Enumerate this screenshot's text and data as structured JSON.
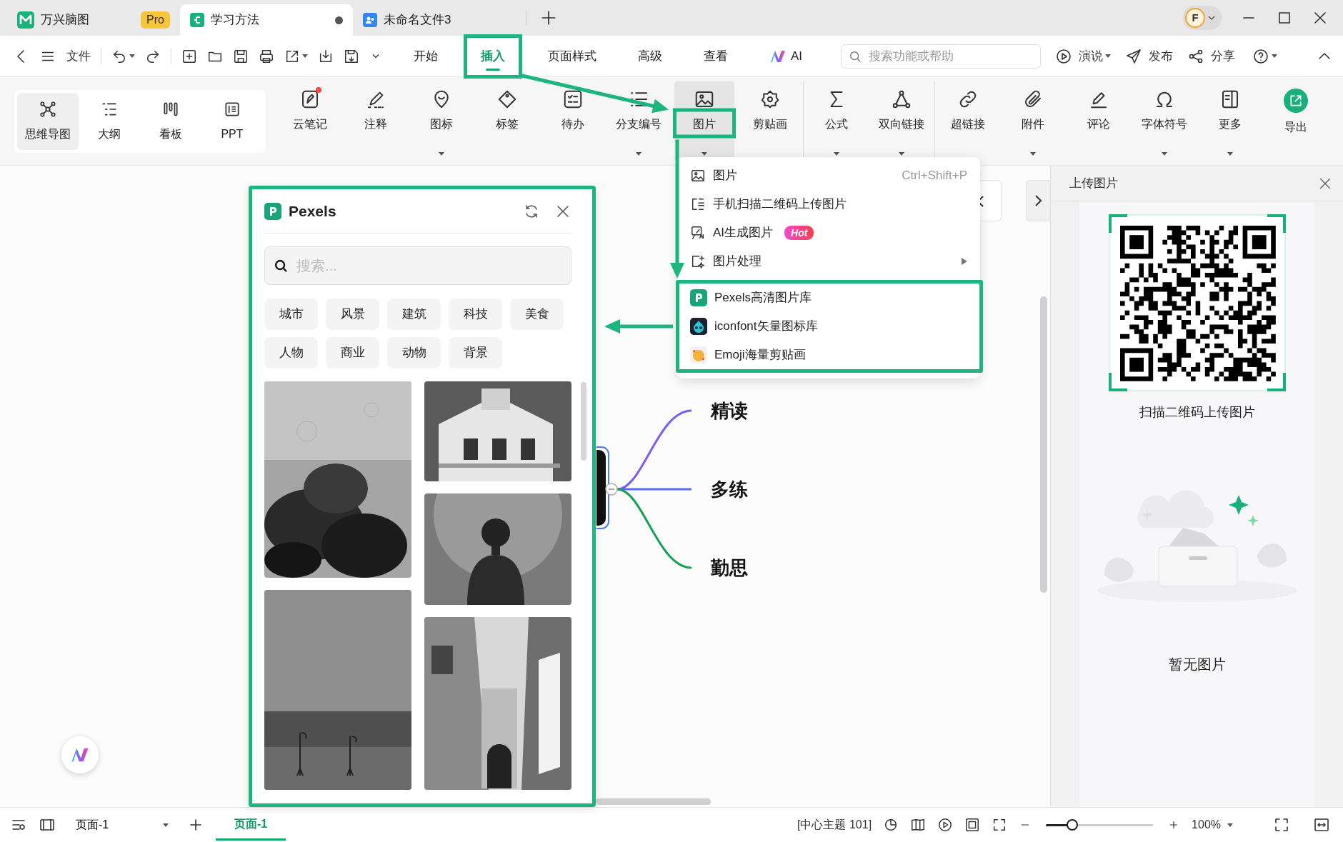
{
  "title_tabs": [
    {
      "label": "万兴脑图",
      "badge": "Pro",
      "selected": false,
      "unsaved": false
    },
    {
      "label": "学习方法",
      "selected": true,
      "unsaved": true
    },
    {
      "label": "未命名文件3",
      "selected": false,
      "unsaved": false
    }
  ],
  "account": {
    "avatar": "F"
  },
  "menu_bar": {
    "file": "文件",
    "tabs": [
      {
        "label": "开始",
        "selected": false,
        "highlighted": false,
        "kind": "text"
      },
      {
        "label": "插入",
        "selected": true,
        "highlighted": true,
        "kind": "text"
      },
      {
        "label": "页面样式",
        "selected": false,
        "highlighted": false,
        "kind": "text"
      },
      {
        "label": "高级",
        "selected": false,
        "highlighted": false,
        "kind": "text"
      },
      {
        "label": "查看",
        "selected": false,
        "highlighted": false,
        "kind": "text"
      },
      {
        "label": "AI",
        "selected": false,
        "highlighted": false,
        "kind": "ai"
      }
    ],
    "search": {
      "placeholder": "搜索功能或帮助"
    },
    "actions": [
      {
        "label": "演说",
        "dropdown": true
      },
      {
        "label": "发布",
        "dropdown": false
      },
      {
        "label": "分享",
        "dropdown": false
      }
    ]
  },
  "ribbon": {
    "views": [
      {
        "label": "思维导图",
        "selected": true
      },
      {
        "label": "大纲",
        "selected": false
      },
      {
        "label": "看板",
        "selected": false
      },
      {
        "label": "PPT",
        "selected": false
      }
    ],
    "tools": [
      {
        "label": "云笔记",
        "kind": "plain",
        "dropdown": false,
        "selected": false,
        "highlighted": false,
        "dot": true,
        "divider_before": false
      },
      {
        "label": "注释",
        "kind": "plain",
        "dropdown": false,
        "selected": false,
        "highlighted": false,
        "dot": false,
        "divider_before": false
      },
      {
        "label": "图标",
        "kind": "plain",
        "dropdown": true,
        "selected": false,
        "highlighted": false,
        "dot": false,
        "divider_before": false
      },
      {
        "label": "标签",
        "kind": "plain",
        "dropdown": false,
        "selected": false,
        "highlighted": false,
        "dot": false,
        "divider_before": false
      },
      {
        "label": "待办",
        "kind": "plain",
        "dropdown": false,
        "selected": false,
        "highlighted": false,
        "dot": false,
        "divider_before": false
      },
      {
        "label": "分支编号",
        "kind": "plain",
        "dropdown": true,
        "selected": false,
        "highlighted": false,
        "dot": false,
        "divider_before": false
      },
      {
        "label": "图片",
        "kind": "plain",
        "dropdown": true,
        "selected": true,
        "highlighted": true,
        "dot": false,
        "divider_before": false
      },
      {
        "label": "剪贴画",
        "kind": "plain",
        "dropdown": false,
        "selected": false,
        "highlighted": false,
        "dot": false,
        "divider_before": false
      },
      {
        "label": "公式",
        "kind": "plain",
        "dropdown": true,
        "selected": false,
        "highlighted": false,
        "dot": false,
        "divider_before": true
      },
      {
        "label": "双向链接",
        "kind": "plain",
        "dropdown": true,
        "selected": false,
        "highlighted": false,
        "dot": false,
        "divider_before": false
      },
      {
        "label": "超链接",
        "kind": "plain",
        "dropdown": false,
        "selected": false,
        "highlighted": false,
        "dot": false,
        "divider_before": true
      },
      {
        "label": "附件",
        "kind": "plain",
        "dropdown": true,
        "selected": false,
        "highlighted": false,
        "dot": false,
        "divider_before": false
      },
      {
        "label": "评论",
        "kind": "plain",
        "dropdown": false,
        "selected": false,
        "highlighted": false,
        "dot": false,
        "divider_before": false
      },
      {
        "label": "字体符号",
        "kind": "plain",
        "dropdown": true,
        "selected": false,
        "highlighted": false,
        "dot": false,
        "divider_before": false
      },
      {
        "label": "更多",
        "kind": "plain",
        "dropdown": true,
        "selected": false,
        "highlighted": false,
        "dot": false,
        "divider_before": false
      },
      {
        "label": "导出",
        "kind": "export",
        "dropdown": false,
        "selected": false,
        "highlighted": false,
        "dot": false,
        "divider_before": false
      }
    ]
  },
  "picture_menu": {
    "items": [
      {
        "label": "图片",
        "shortcut": "Ctrl+Shift+P",
        "submenu": false
      },
      {
        "label": "手机扫描二维码上传图片",
        "submenu": false
      },
      {
        "label": "AI生成图片",
        "badge": "Hot",
        "submenu": false
      },
      {
        "label": "图片处理",
        "submenu": true
      }
    ],
    "library_group": {
      "highlighted": true,
      "items": [
        {
          "label": "Pexels高清图片库"
        },
        {
          "label": "iconfont矢量图标库"
        },
        {
          "label": "Emoji海量剪贴画"
        }
      ]
    }
  },
  "pexels_panel": {
    "title": "Pexels",
    "highlighted": true,
    "search": {
      "placeholder": "搜索..."
    },
    "tags": [
      "城市",
      "风景",
      "建筑",
      "科技",
      "美食",
      "人物",
      "商业",
      "动物",
      "背景"
    ]
  },
  "mind_map": {
    "branches": [
      {
        "label": "精读",
        "color": "#7b5cf5"
      },
      {
        "label": "多练",
        "color": "#5b6af0"
      },
      {
        "label": "勤思",
        "color": "#14a154"
      }
    ]
  },
  "upload_panel": {
    "title": "上传图片",
    "qr_caption": "扫描二维码上传图片",
    "empty_text": "暂无图片"
  },
  "status_bar": {
    "page_select": "页面-1",
    "pages": [
      {
        "label": "页面-1",
        "selected": true
      }
    ],
    "topic_count": "[中心主题 101]",
    "zoom": {
      "level": 0.26,
      "reading": "100%"
    }
  }
}
